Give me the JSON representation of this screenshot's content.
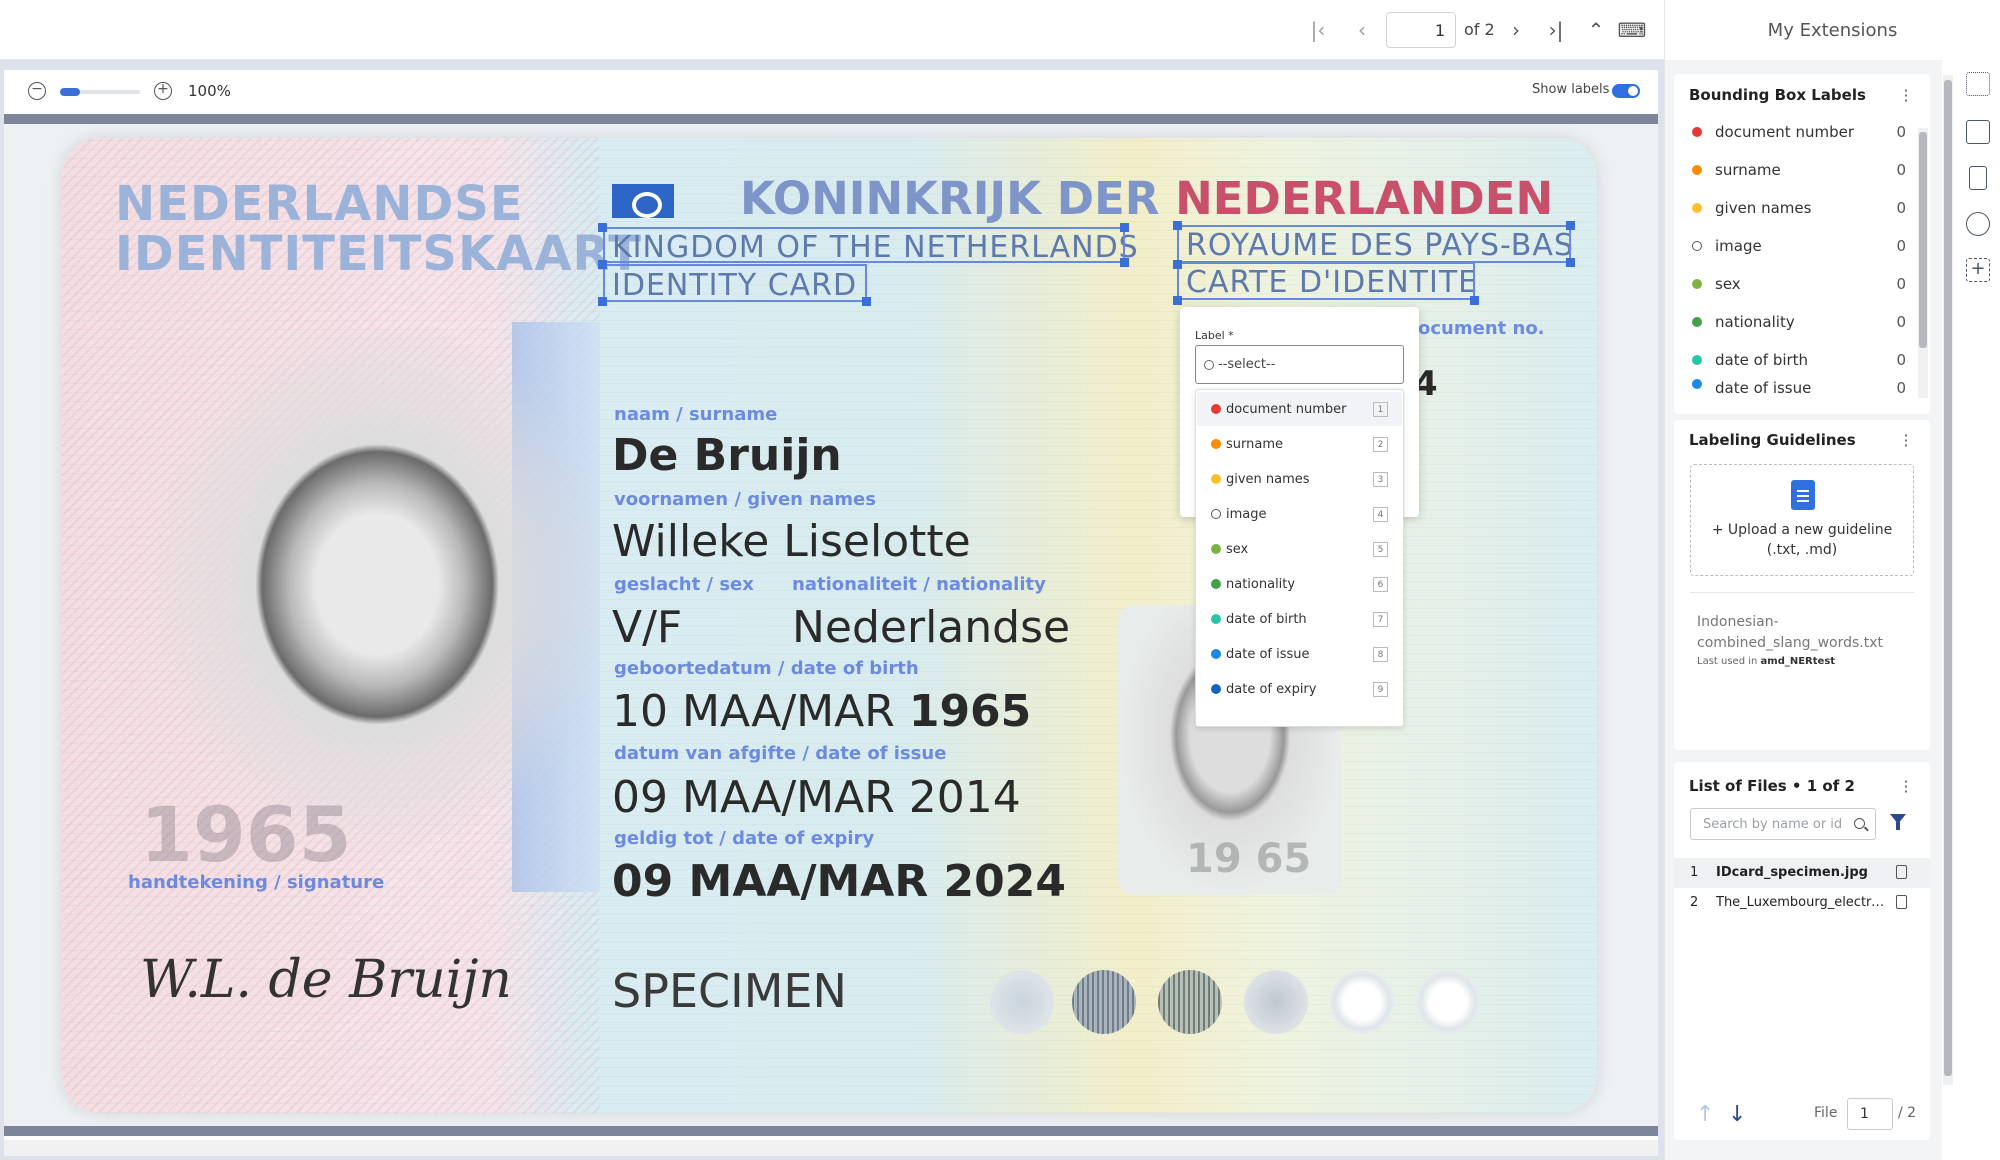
{
  "toolbar": {
    "page_value": "1",
    "page_of": "of 2",
    "extensions_title": "My Extensions"
  },
  "viewer": {
    "zoom": "100%",
    "show_labels": "Show labels",
    "show_labels_on": true
  },
  "card": {
    "nl_title_line1": "NEDERLANDSE",
    "nl_title_line2": "IDENTITEITSKAART",
    "kingdom_nl_a": "KONINKRIJK DER ",
    "kingdom_nl_b": "NEDERLANDEN",
    "kingdom_en": "KINGDOM OF THE NETHERLANDS",
    "identity_card": "IDENTITY CARD",
    "royaume": "ROYAUME DES PAYS-BAS",
    "carte": "CARTE D'IDENTITE",
    "document_no_label": "ocument no.",
    "surname_label": "naam / surname",
    "surname": "De Bruijn",
    "given_names_label": "voornamen / given names",
    "given_names": "Willeke Liselotte",
    "sex_label": "geslacht / sex",
    "nationality_label": "nationaliteit / nationality",
    "sex": "V/F",
    "nationality": "Nederlandse",
    "dob_label": "geboortedatum / date of birth",
    "dob_a": "10 MAA/MAR",
    "dob_b": "1965",
    "doi_label": "datum van afgifte / date of issue",
    "doi": "09 MAA/MAR 2014",
    "doe_label": "geldig tot / date of expiry",
    "doe": "09 MAA/MAR 2024",
    "photo_year": "1965",
    "signature_label": "handtekening / signature",
    "signature": "W.L. de Bruijn",
    "specimen": "SPECIMEN",
    "mini_photo_year": "19 65",
    "docno_fragment": "4"
  },
  "label_popup": {
    "title": "Label *",
    "placeholder": "--select--",
    "options": [
      {
        "label": "document number",
        "key": "1",
        "color": "#e53935"
      },
      {
        "label": "surname",
        "key": "2",
        "color": "#fb8c00"
      },
      {
        "label": "given names",
        "key": "3",
        "color": "#fbc02d"
      },
      {
        "label": "image",
        "key": "4",
        "color": "hollow"
      },
      {
        "label": "sex",
        "key": "5",
        "color": "#7cb342"
      },
      {
        "label": "nationality",
        "key": "6",
        "color": "#43a047"
      },
      {
        "label": "date of birth",
        "key": "7",
        "color": "#26c6a6"
      },
      {
        "label": "date of issue",
        "key": "8",
        "color": "#1e88e5"
      },
      {
        "label": "date of expiry",
        "key": "9",
        "color": "#1565c0"
      }
    ]
  },
  "bbox_panel": {
    "title": "Bounding Box Labels",
    "items": [
      {
        "label": "document number",
        "count": "0",
        "color": "#e53935"
      },
      {
        "label": "surname",
        "count": "0",
        "color": "#fb8c00"
      },
      {
        "label": "given names",
        "count": "0",
        "color": "#fbc02d"
      },
      {
        "label": "image",
        "count": "0",
        "color": "hollow"
      },
      {
        "label": "sex",
        "count": "0",
        "color": "#7cb342"
      },
      {
        "label": "nationality",
        "count": "0",
        "color": "#43a047"
      },
      {
        "label": "date of birth",
        "count": "0",
        "color": "#26c6a6"
      },
      {
        "label": "date of issue",
        "count": "0",
        "color": "#1e88e5"
      }
    ]
  },
  "guidelines": {
    "title": "Labeling Guidelines",
    "upload_line1": "+ Upload a new guideline",
    "upload_line2": "(.txt, .md)",
    "file_name": "Indonesian-combined_slang_words.txt",
    "last_used_prefix": "Last used in ",
    "last_used_project": "amd_NERtest"
  },
  "files": {
    "title": "List of Files • 1 of 2",
    "search_placeholder": "Search by name or id",
    "rows": [
      {
        "index": "1",
        "name": "IDcard_specimen.jpg"
      },
      {
        "index": "2",
        "name": "The_Luxembourg_electronic_ID_card.jpg"
      }
    ],
    "file_label": "File",
    "file_value": "1",
    "file_total": "/ 2"
  }
}
